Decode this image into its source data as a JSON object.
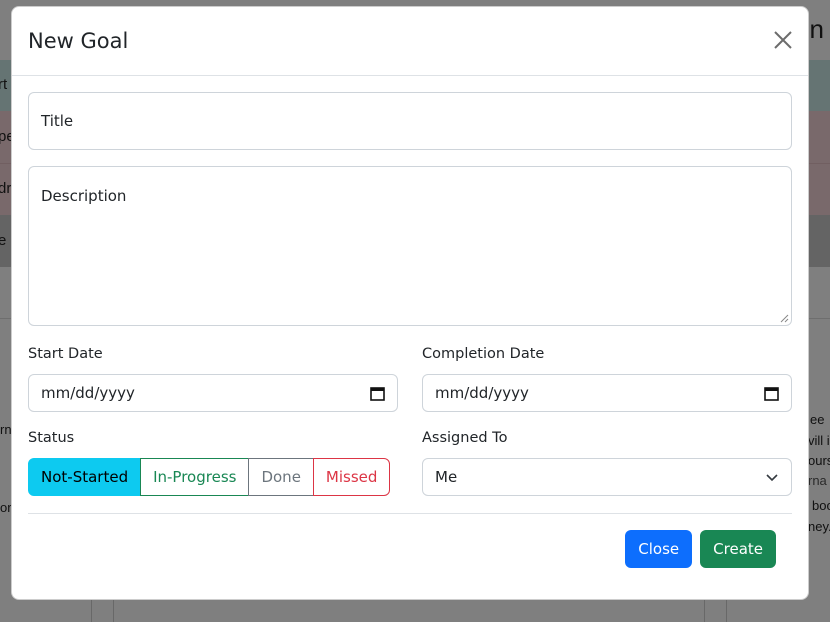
{
  "background": {
    "heading_fragment": "n",
    "row_fragments": [
      "rt",
      "pe",
      "dr",
      "e"
    ],
    "side_text_right": [
      "ee",
      "vill in",
      "ours",
      "rna",
      "boo",
      "ney."
    ],
    "side_text_left": [
      "rn",
      "or"
    ]
  },
  "modal": {
    "title": "New Goal",
    "close_icon": "close-icon",
    "fields": {
      "title_placeholder": "Title",
      "description_placeholder": "Description",
      "start_date": {
        "label": "Start Date",
        "placeholder": "mm/dd/yyyy"
      },
      "completion_date": {
        "label": "Completion Date",
        "placeholder": "mm/dd/yyyy"
      },
      "status": {
        "label": "Status",
        "options": [
          "Not-Started",
          "In-Progress",
          "Done",
          "Missed"
        ],
        "selected": "Not-Started"
      },
      "assigned_to": {
        "label": "Assigned To",
        "selected": "Me"
      }
    },
    "footer": {
      "close_label": "Close",
      "create_label": "Create"
    }
  },
  "colors": {
    "primary": "#0d6efd",
    "success": "#198754",
    "info": "#0dcaf0",
    "secondary": "#6c757d",
    "danger": "#dc3545"
  }
}
